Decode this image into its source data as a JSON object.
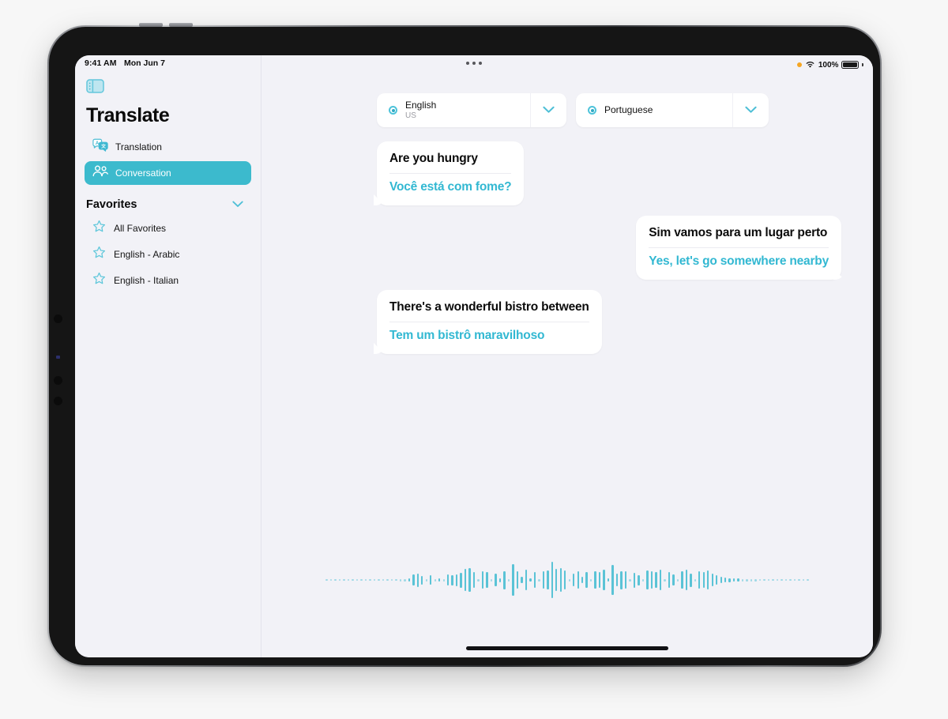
{
  "status_bar": {
    "time": "9:41 AM",
    "date": "Mon Jun 7",
    "battery_percent": "100%",
    "mic_indicator": "orange-dot-icon",
    "wifi_icon": "wifi-icon",
    "battery_icon": "battery-full-icon",
    "multitask_icon": "multitask-dots-icon"
  },
  "sidebar": {
    "toggle_icon": "sidebar-toggle-icon",
    "app_title": "Translate",
    "nav_items": [
      {
        "label": "Translation",
        "icon": "translate-bubbles-icon",
        "selected": false
      },
      {
        "label": "Conversation",
        "icon": "two-people-icon",
        "selected": true
      }
    ],
    "favorites": {
      "title": "Favorites",
      "chevron_icon": "chevron-down-icon",
      "items": [
        {
          "label": "All Favorites",
          "icon": "star-icon"
        },
        {
          "label": "English - Arabic",
          "icon": "star-icon"
        },
        {
          "label": "English - Italian",
          "icon": "star-icon"
        }
      ]
    }
  },
  "language_selectors": {
    "source": {
      "name": "English",
      "region": "US",
      "dot_icon": "language-dot-icon",
      "chevron_icon": "chevron-down-icon"
    },
    "target": {
      "name": "Portuguese",
      "region": "",
      "dot_icon": "language-dot-icon",
      "chevron_icon": "chevron-down-icon"
    }
  },
  "conversation": [
    {
      "align": "left",
      "source": "Are you hungry",
      "translation": "Você está com fome?"
    },
    {
      "align": "right",
      "source": "Sim vamos para um lugar perto",
      "translation": "Yes, let's go somewhere nearby"
    },
    {
      "align": "left",
      "source": "There's a wonderful bistro between",
      "translation": "Tem um bistrô maravilhoso"
    }
  ],
  "waveform": {
    "label": "listening-waveform",
    "bar_heights": [
      2,
      2,
      2,
      2,
      2,
      2,
      2,
      2,
      2,
      2,
      2,
      2,
      2,
      2,
      2,
      2,
      2,
      3,
      3,
      4,
      14,
      17,
      11,
      3,
      12,
      3,
      4,
      3,
      14,
      13,
      15,
      19,
      28,
      30,
      20,
      3,
      22,
      20,
      3,
      16,
      5,
      23,
      3,
      40,
      22,
      8,
      26,
      4,
      20,
      3,
      22,
      24,
      46,
      28,
      30,
      24,
      3,
      16,
      22,
      8,
      20,
      3,
      22,
      20,
      26,
      4,
      38,
      16,
      23,
      22,
      3,
      19,
      13,
      3,
      24,
      22,
      20,
      26,
      3,
      20,
      14,
      3,
      22,
      26,
      17,
      3,
      22,
      20,
      24,
      16,
      12,
      8,
      6,
      5,
      4,
      4,
      3,
      3,
      3,
      3,
      2,
      2,
      2,
      2,
      2,
      2,
      2,
      2,
      2,
      2,
      2,
      2
    ]
  },
  "home_indicator": "home-indicator"
}
